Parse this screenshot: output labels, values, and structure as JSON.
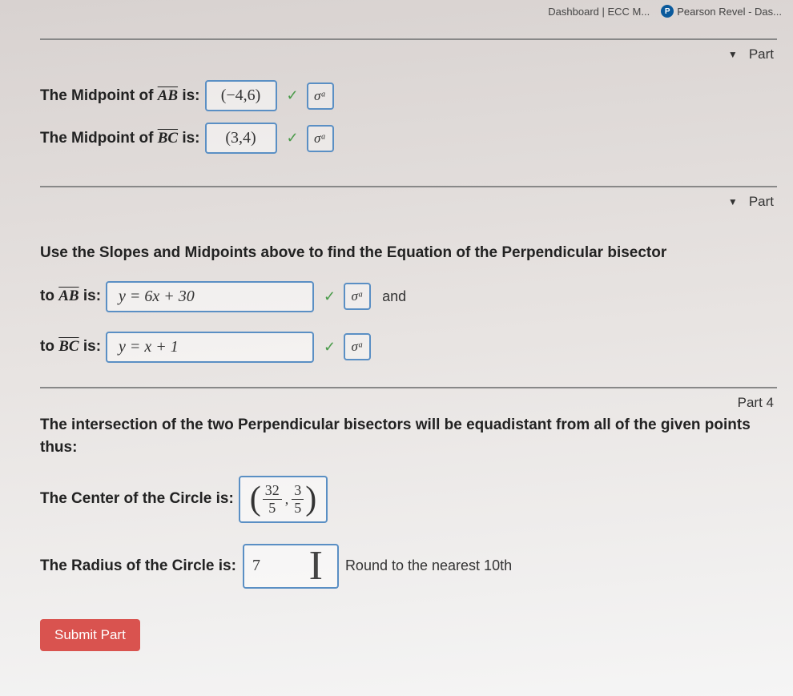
{
  "tabs": {
    "dashboard": "Dashboard | ECC M...",
    "pearson": "Pearson Revel - Das..."
  },
  "part1": {
    "toggle_label": "Part",
    "midpoint_ab_label_pre": "The Midpoint of ",
    "midpoint_ab_seg": "AB",
    "midpoint_ab_label_post": " is:",
    "midpoint_ab_value": "(−4,6)",
    "midpoint_bc_label_pre": "The Midpoint of ",
    "midpoint_bc_seg": "BC",
    "midpoint_bc_label_post": " is:",
    "midpoint_bc_value": "(3,4)"
  },
  "part2": {
    "toggle_label": "Part",
    "instruction": "Use the Slopes and Midpoints above to find the Equation of the Perpendicular bisector",
    "to_ab_pre": "to ",
    "to_ab_seg": "AB",
    "to_ab_post": " is:",
    "ab_eq": "y = 6x + 30",
    "and_text": "and",
    "to_bc_pre": "to ",
    "to_bc_seg": "BC",
    "to_bc_post": " is:",
    "bc_eq": "y = x + 1"
  },
  "part3": {
    "toggle_label": "Part 4",
    "text": "The intersection of the two Perpendicular bisectors will be equadistant from all of the given points thus:",
    "center_label": "The Center of the Circle is:",
    "center_n1": "32",
    "center_d1": "5",
    "center_n2": "3",
    "center_d2": "5",
    "radius_label": "The Radius of the Circle is:",
    "radius_value": "7",
    "radius_hint": "Round to the nearest 10th"
  },
  "buttons": {
    "submit": "Submit Part",
    "sigma": "σᵃ"
  },
  "icons": {
    "check": "✓",
    "triangle": "▼"
  }
}
